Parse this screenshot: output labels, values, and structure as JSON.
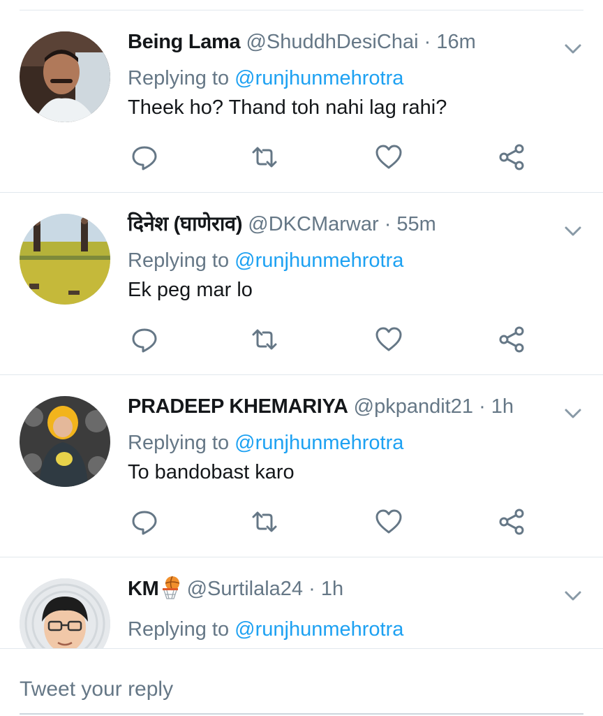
{
  "tweets": [
    {
      "name": "Being Lama",
      "handle": "@ShuddhDesiChai",
      "separator": "·",
      "time": "16m",
      "replying_prefix": "Replying to",
      "replying_to": "@runjhunmehrotra",
      "text": "Theek ho? Thand toh nahi lag rahi?"
    },
    {
      "name": "दिनेश (घाणेराव)",
      "handle": "@DKCMarwar",
      "separator": "·",
      "time": "55m",
      "replying_prefix": "Replying to",
      "replying_to": "@runjhunmehrotra",
      "text": "Ek peg mar lo"
    },
    {
      "name": "PRADEEP KHEMARIYA",
      "handle": "@pkpandit21",
      "separator": "·",
      "time": "1h",
      "replying_prefix": "Replying to",
      "replying_to": "@runjhunmehrotra",
      "text": "To bandobast karo"
    },
    {
      "name": "KM",
      "name_emoji": "basketball-hoop-emoji",
      "handle": "@Surtilala24",
      "separator": "·",
      "time": "1h",
      "replying_prefix": "Replying to",
      "replying_to": "@runjhunmehrotra",
      "text": ""
    }
  ],
  "icons": {
    "reply": "reply-icon",
    "retweet": "retweet-icon",
    "like": "like-icon",
    "share": "share-icon",
    "more": "chevron-down-icon"
  },
  "colors": {
    "mention": "#1da1f2",
    "secondary_text": "#657786",
    "primary_text": "#14171a",
    "divider": "#e1e8ed"
  },
  "compose": {
    "placeholder": "Tweet your reply"
  }
}
